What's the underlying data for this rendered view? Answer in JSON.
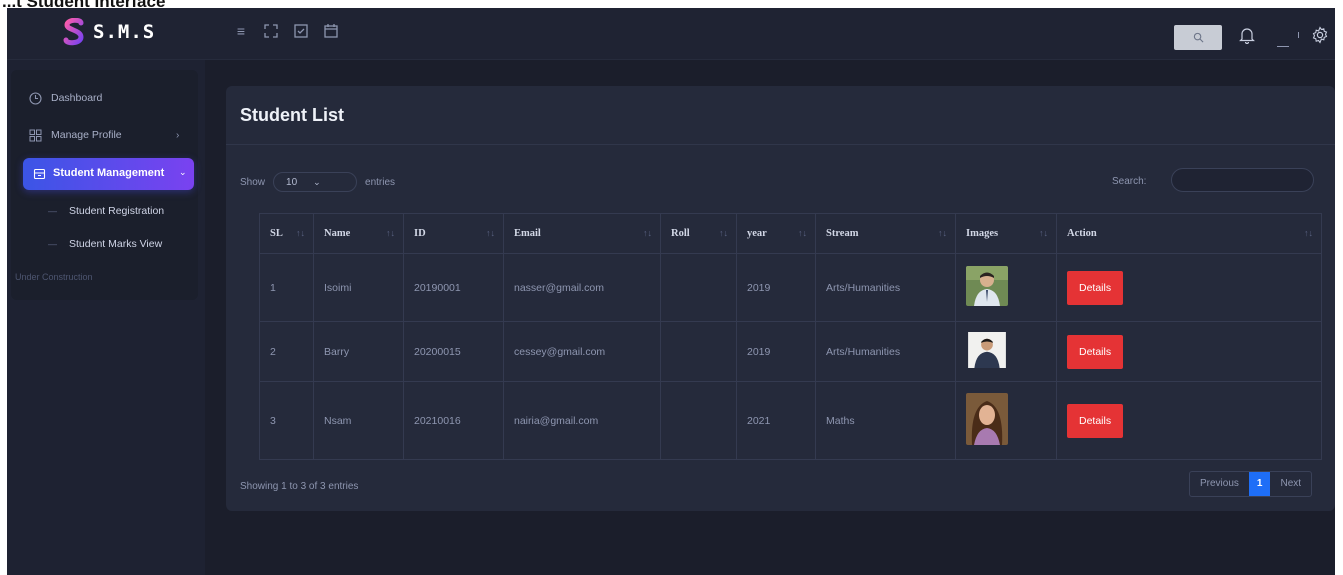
{
  "caption": "...t Student Interface",
  "brand": {
    "name": "S.M.S"
  },
  "topbar": {
    "icons": [
      "menu-icon",
      "expand-icon",
      "checklist-icon",
      "calendar-icon"
    ],
    "search_icon": "search-icon",
    "bell_icon": "bell-icon",
    "settings_icon": "gear-icon"
  },
  "sidebar": {
    "items": [
      {
        "label": "Dashboard",
        "icon": "clock-icon"
      },
      {
        "label": "Manage Profile",
        "icon": "grid-icon",
        "arrow": "›"
      },
      {
        "label": "Student Management",
        "icon": "archive-icon",
        "arrow": "⌄",
        "active": true
      },
      {
        "label": "Student Registration",
        "sub": true
      },
      {
        "label": "Student Marks View",
        "sub": true
      }
    ],
    "note": "Under Construction"
  },
  "card": {
    "title": "Student List",
    "show_label": "Show",
    "show_value": "10",
    "entries_label": "entries",
    "search_label": "Search:"
  },
  "table": {
    "headers": [
      "SL",
      "Name",
      "ID",
      "Email",
      "Roll",
      "year",
      "Stream",
      "Images",
      "Action"
    ],
    "rows": [
      {
        "sl": "1",
        "name": "Isoimi",
        "id": "20190001",
        "email": "nasser@gmail.com",
        "roll": "",
        "year": "2019",
        "stream": "Arts/Humanities",
        "action": "Details"
      },
      {
        "sl": "2",
        "name": "Barry",
        "id": "20200015",
        "email": "cessey@gmail.com",
        "roll": "",
        "year": "2019",
        "stream": "Arts/Humanities",
        "action": "Details"
      },
      {
        "sl": "3",
        "name": "Nsam",
        "id": "20210016",
        "email": "nairia@gmail.com",
        "roll": "",
        "year": "2021",
        "stream": "Maths",
        "action": "Details"
      }
    ]
  },
  "footer": {
    "info": "Showing 1 to 3 of 3 entries",
    "previous": "Previous",
    "current_page": "1",
    "next": "Next"
  },
  "colors": {
    "background": "#1e2232",
    "card": "#252a3b",
    "accent_start": "#3b55e6",
    "accent_end": "#7a42f0",
    "details_button": "#e53335",
    "pager_active": "#1e6ef7"
  }
}
